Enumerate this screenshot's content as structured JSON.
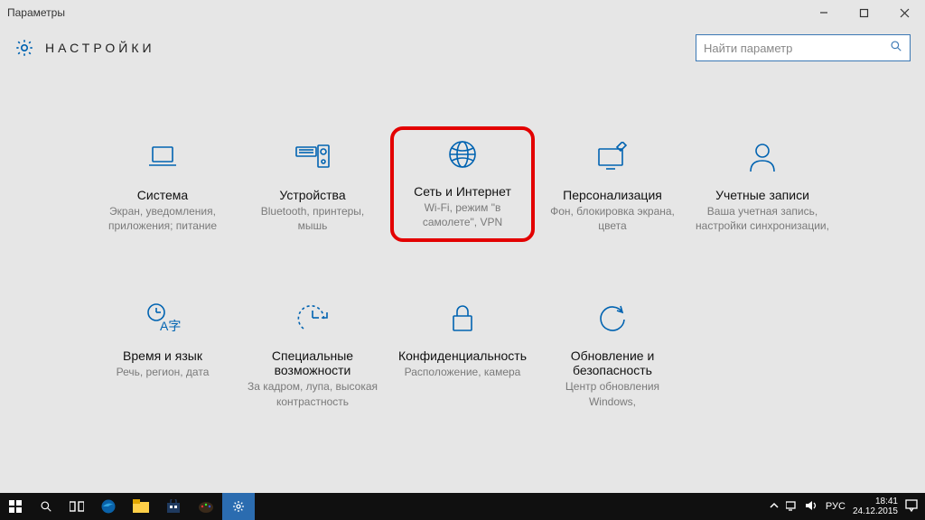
{
  "window": {
    "title": "Параметры"
  },
  "header": {
    "title": "НАСТРОЙКИ"
  },
  "search": {
    "placeholder": "Найти параметр"
  },
  "tiles": [
    {
      "id": "system",
      "label": "Система",
      "desc": "Экран, уведомления, приложения; питание",
      "highlight": false
    },
    {
      "id": "devices",
      "label": "Устройства",
      "desc": "Bluetooth, принтеры, мышь",
      "highlight": false
    },
    {
      "id": "network",
      "label": "Сеть и Интернет",
      "desc": "Wi-Fi, режим \"в самолете\", VPN",
      "highlight": true
    },
    {
      "id": "personalization",
      "label": "Персонализация",
      "desc": "Фон, блокировка экрана, цвета",
      "highlight": false
    },
    {
      "id": "accounts",
      "label": "Учетные записи",
      "desc": "Ваша учетная запись, настройки синхронизации,",
      "highlight": false
    },
    {
      "id": "time-language",
      "label": "Время и язык",
      "desc": "Речь, регион, дата",
      "highlight": false
    },
    {
      "id": "ease-of-access",
      "label": "Специальные возможности",
      "desc": "За кадром, лупа, высокая контрастность",
      "highlight": false
    },
    {
      "id": "privacy",
      "label": "Конфиденциальность",
      "desc": "Расположение, камера",
      "highlight": false
    },
    {
      "id": "update",
      "label": "Обновление и безопасность",
      "desc": "Центр обновления Windows,",
      "highlight": false
    }
  ],
  "tray": {
    "language": "РУС",
    "time": "18:41",
    "date": "24.12.2015"
  }
}
